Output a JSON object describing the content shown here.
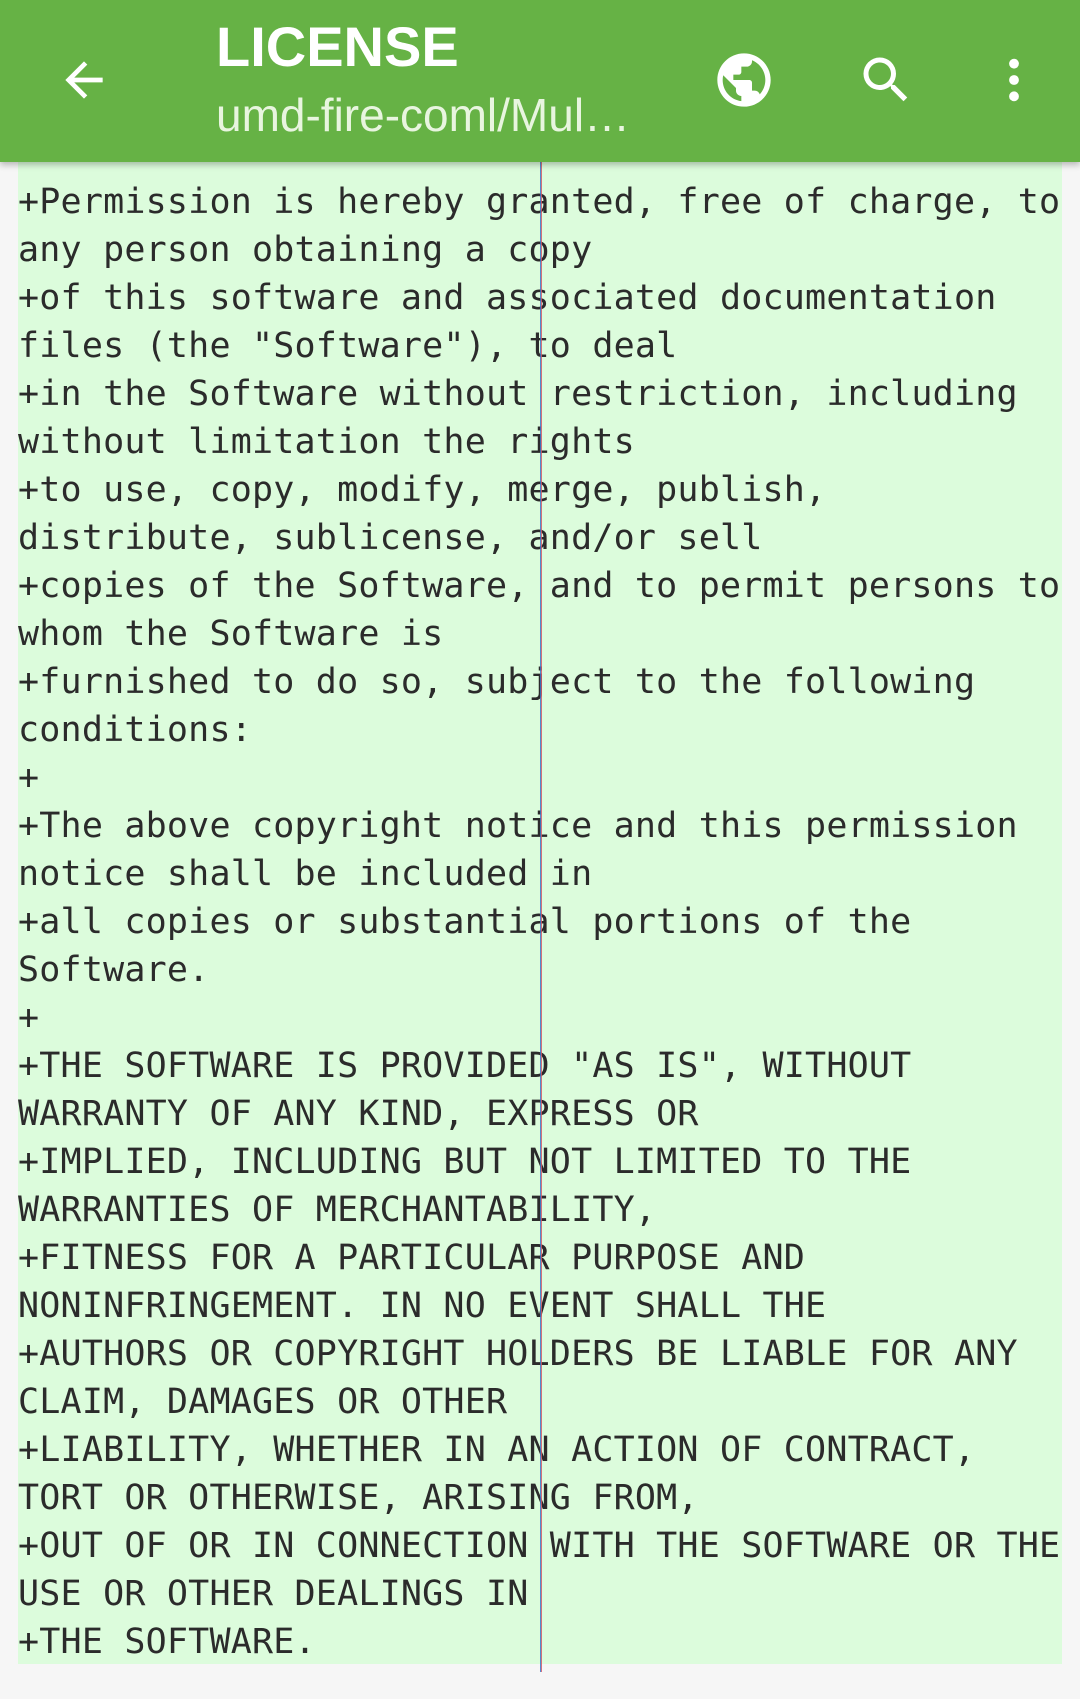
{
  "toolbar": {
    "title": "LICENSE",
    "subtitle": "umd-fire-coml/Mul…",
    "back_icon": "arrow-left-icon",
    "browser_icon": "globe-icon",
    "search_icon": "search-icon",
    "menu_icon": "more-vert-icon"
  },
  "colors": {
    "appbar": "#66b245",
    "added_line_bg": "#dcfcdc",
    "page_bg": "#f6f6f6"
  },
  "diff": {
    "lines": [
      "+Permission is hereby granted, free of charge, to any person obtaining a copy",
      "+of this software and associated documentation files (the \"Software\"), to deal",
      "+in the Software without restriction, including without limitation the rights",
      "+to use, copy, modify, merge, publish, distribute, sublicense, and/or sell",
      "+copies of the Software, and to permit persons to whom the Software is",
      "+furnished to do so, subject to the following conditions:",
      "+",
      "+The above copyright notice and this permission notice shall be included in",
      "+all copies or substantial portions of the Software.",
      "+",
      "+THE SOFTWARE IS PROVIDED \"AS IS\", WITHOUT WARRANTY OF ANY KIND, EXPRESS OR",
      "+IMPLIED, INCLUDING BUT NOT LIMITED TO THE WARRANTIES OF MERCHANTABILITY,",
      "+FITNESS FOR A PARTICULAR PURPOSE AND NONINFRINGEMENT. IN NO EVENT SHALL THE",
      "+AUTHORS OR COPYRIGHT HOLDERS BE LIABLE FOR ANY CLAIM, DAMAGES OR OTHER",
      "+LIABILITY, WHETHER IN AN ACTION OF CONTRACT, TORT OR OTHERWISE, ARISING FROM,",
      "+OUT OF OR IN CONNECTION WITH THE SOFTWARE OR THE USE OR OTHER DEALINGS IN",
      "+THE SOFTWARE."
    ]
  }
}
